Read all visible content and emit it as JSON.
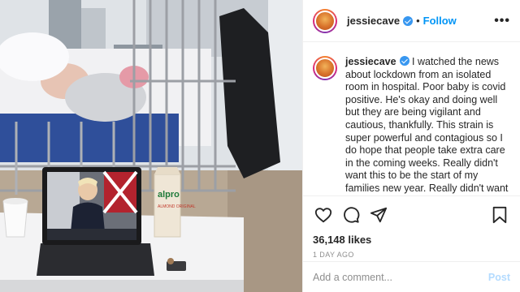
{
  "header": {
    "username": "jessiecave",
    "separator": "•",
    "follow_label": "Follow",
    "more_label": "•••"
  },
  "caption": {
    "username": "jessiecave",
    "text": " I watched the news about lockdown from an isolated room in hospital. Poor baby is covid positive. He's okay and doing well but they are being vigilant and cautious, thankfully. This strain is super powerful and contagious so I do hope that people take extra care in the coming weeks. Really didn't want this to be the start of my families new year. Really didn't want to be back in a hospital so soon after his traumatic birth. Once again"
  },
  "stats": {
    "likes": "36,148 likes",
    "time_ago": "1 DAY AGO"
  },
  "comment": {
    "placeholder": "Add a comment...",
    "post_label": "Post"
  },
  "photo": {
    "carton_brand": "alpro",
    "carton_sub": "ALMOND ORIGINAL"
  },
  "icons": {
    "like": "heart-icon",
    "comment": "comment-icon",
    "share": "share-icon",
    "save": "bookmark-icon",
    "verified": "verified-badge-icon"
  },
  "colors": {
    "follow": "#0095f6",
    "verified": "#3897f0",
    "post_disabled": "#b3dbff",
    "meta_gray": "#8e8e8e"
  }
}
